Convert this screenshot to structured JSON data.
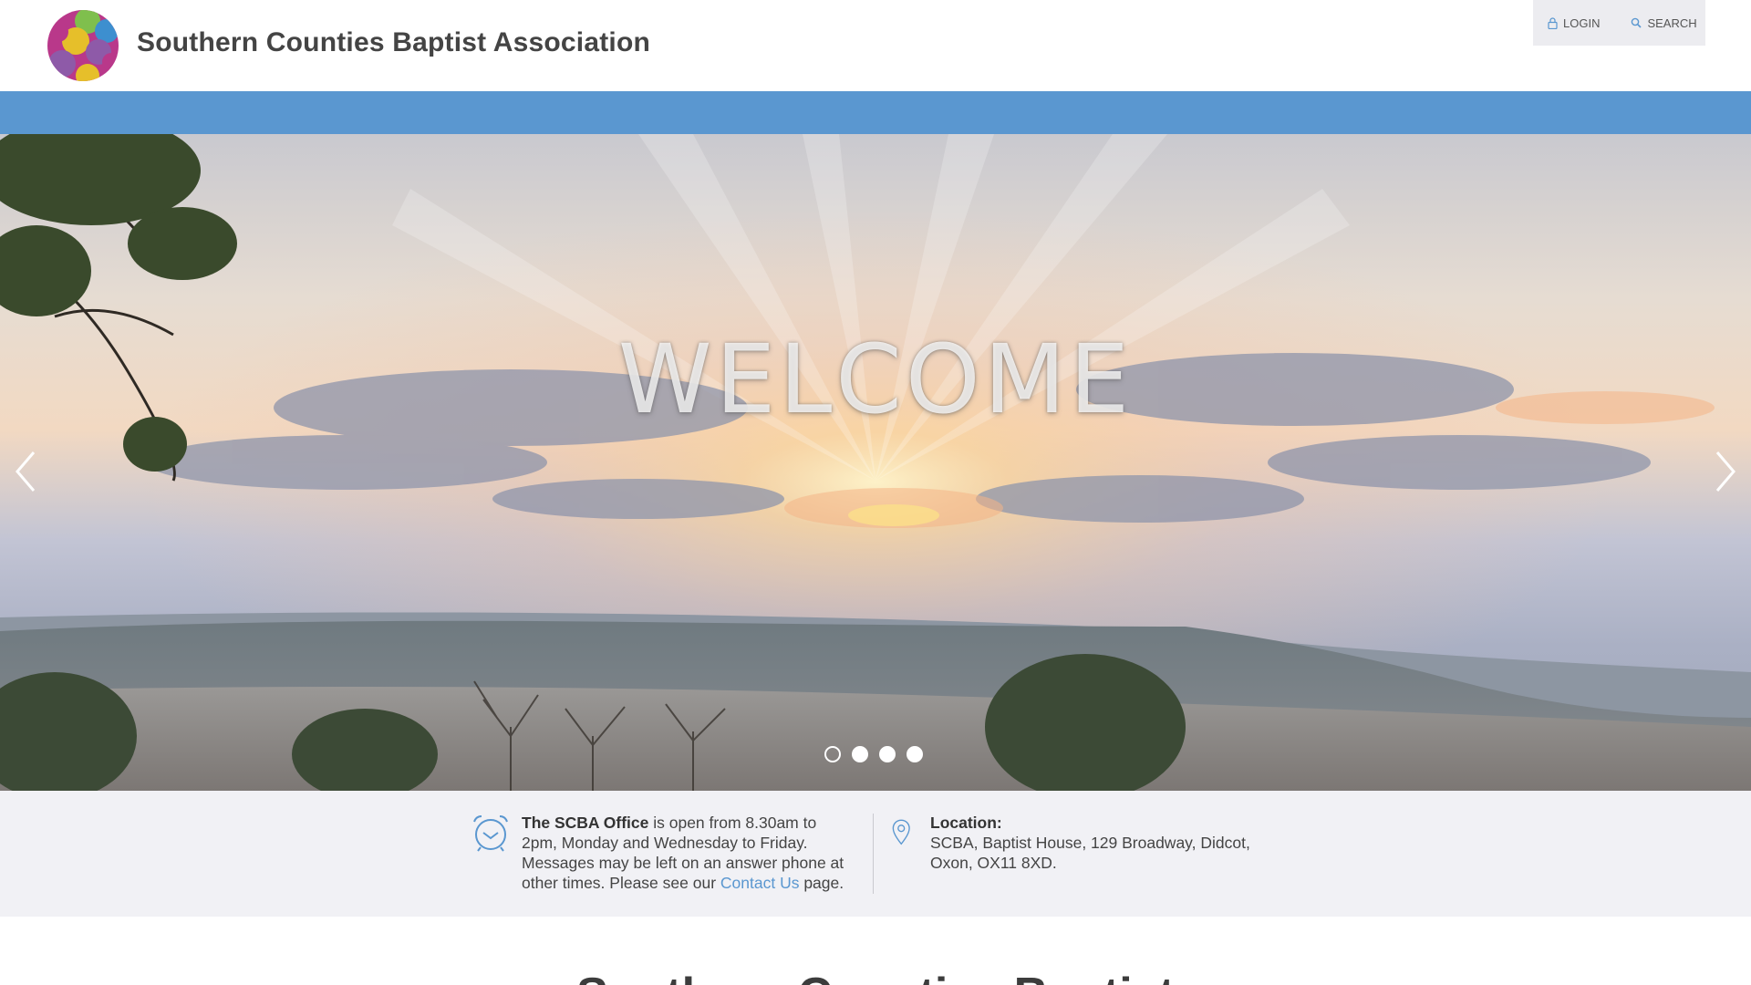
{
  "header": {
    "site_title": "Southern Counties Baptist Association",
    "login_label": "LOGIN",
    "search_label": "SEARCH"
  },
  "hero": {
    "title": "WELCOME",
    "slide_count": 4,
    "active_slide": 1
  },
  "info": {
    "office_name": "The SCBA Office",
    "office_text": " is open from 8.30am to 2pm, Monday and Wednesday to Friday. Messages may be left on an answer phone at other times. Please see our ",
    "office_link": "Contact Us",
    "office_tail": " page.",
    "location_label": "Location:",
    "location_text": "SCBA, Baptist House, 129 Broadway, Didcot, Oxon, OX11 8XD."
  },
  "section": {
    "heading": "Southern Counties Baptist"
  },
  "colors": {
    "nav_bar": "#5a97d0",
    "link": "#5a97d0",
    "info_bg": "#f1f1f5",
    "util_bg": "#ececf0"
  },
  "icons": [
    "lock-icon",
    "search-icon",
    "alarm-clock-icon",
    "map-pin-icon",
    "chevron-left-icon",
    "chevron-right-icon"
  ]
}
